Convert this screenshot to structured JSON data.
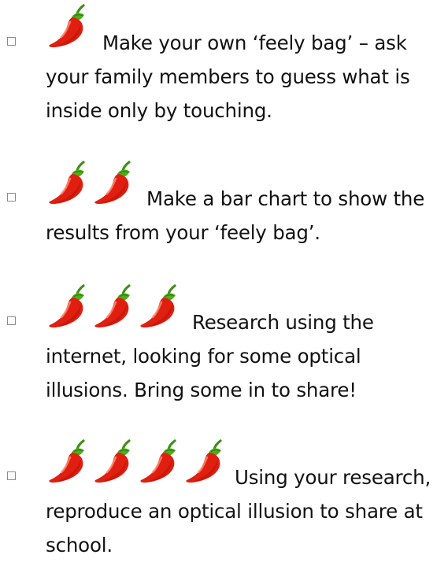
{
  "colors": {
    "chili_red": "#e01f10",
    "chili_green": "#4caf1a",
    "checkbox_border": "#8a8a8a",
    "text": "#111111"
  },
  "icons": {
    "checkbox": "checkbox-icon",
    "difficulty": "chili-pepper-icon"
  },
  "tasks": [
    {
      "chili_count": 1,
      "text": "Make your own ‘feely bag’ – ask your family members to guess what is inside only by touching."
    },
    {
      "chili_count": 2,
      "text": "Make a bar chart to show the results from your ‘feely bag’."
    },
    {
      "chili_count": 3,
      "text": "Research using the internet, looking for some optical illusions. Bring some in to share!"
    },
    {
      "chili_count": 4,
      "text": "Using your research, reproduce an optical illusion to share at school."
    }
  ]
}
